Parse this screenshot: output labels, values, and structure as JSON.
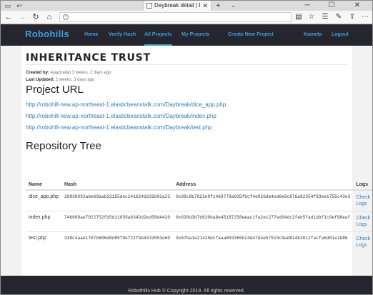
{
  "browser": {
    "tab_title": "Daybreak detail | Project",
    "address_url": ""
  },
  "site": {
    "brand": "Robohills",
    "nav": [
      {
        "label": "Home"
      },
      {
        "label": "Verify Hash"
      },
      {
        "label": "All Projects"
      },
      {
        "label": "My Projects"
      },
      {
        "label": "Create New Project"
      }
    ],
    "user": "Kameta",
    "logout": "Logout"
  },
  "project": {
    "title": "INHERITANCE TRUST",
    "created_label": "Created by:",
    "created_value": "Ajaypratap 3 weeks, 2 days ago",
    "updated_label": "Last Updated:",
    "updated_value": "2 weeks, 3 days ago"
  },
  "project_url": {
    "heading": "Project URL",
    "links": [
      "http://robohill-new.ap-northeast-1.elasticbeanstalk.com/Daybreak/dice_app.php",
      "http://robohill-new.ap-northeast-1.elasticbeanstalk.com/Daybreak/index.php",
      "http://robohill-new.ap-northeast-1.elasticbeanstalk.com/Daybreak/test.php"
    ]
  },
  "repo": {
    "heading": "Repository Tree",
    "columns": [
      "Name",
      "Hash",
      "Address",
      "Logs"
    ],
    "rows": [
      {
        "name": "dice_app.php",
        "hash": "28830092abe69aab32155dec2416241632b02a23",
        "address": "0x09c8b7823e9f1468778a035fbcf4e926db4ed6e8c876a82354f83ee1755c43e3",
        "logs": "Check Logs"
      },
      {
        "name": "index.php",
        "hash": "746608ae7022752fd5d11858a6343d2ed58d4420",
        "address": "0x620d3b7d630ba8e45187258eeac1fa2ec277ed04dc2feb5fad1dbf1c8ef98eaf",
        "logs": "Check Logs"
      },
      {
        "name": "test.php",
        "hash": "339c4aae1707b606d8d85f9ef22fbb437d553e60",
        "address": "0x67ba1e21420dcfaaa804365b24d47d4e57519c9ad814b3012facfa5d61e1b86",
        "logs": "Check Logs"
      }
    ]
  },
  "footer": "Robothills Hub © Copyright 2019. All rights reserved."
}
